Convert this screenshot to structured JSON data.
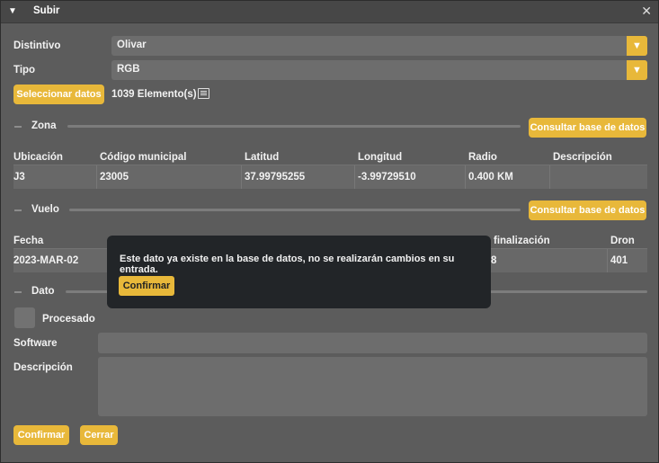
{
  "window": {
    "title": "Subir",
    "collapse_icon": "triangle-down-icon",
    "close_icon": "close-icon",
    "close_glyph": "✕"
  },
  "form": {
    "distintivo": {
      "label": "Distintivo",
      "value": "Olivar"
    },
    "tipo": {
      "label": "Tipo",
      "value": "RGB"
    },
    "select_data_button": "Seleccionar datos",
    "elements_count": "1039 Elemento(s)",
    "list_icon": "list-icon"
  },
  "zona": {
    "title": "Zona",
    "query_button": "Consultar base de datos",
    "columns": [
      "Ubicación",
      "Código municipal",
      "Latitud",
      "Longitud",
      "Radio",
      "Descripción"
    ],
    "rows": [
      [
        "J3",
        "23005",
        "37.99795255",
        "-3.99729510",
        "0.400 KM",
        ""
      ]
    ]
  },
  "vuelo": {
    "title": "Vuelo",
    "query_button": "Consultar base de datos",
    "columns_visible": {
      "fecha": "Fecha",
      "fin": "finalización",
      "dron": "Dron"
    },
    "row": {
      "fecha": "2023-MAR-02",
      "fin": "8",
      "dron": "401"
    }
  },
  "dato": {
    "title": "Dato",
    "procesado_label": "Procesado",
    "procesado_checked": false,
    "software_label": "Software",
    "software_value": "",
    "descripcion_label": "Descripción",
    "descripcion_value": ""
  },
  "footer": {
    "confirm_button": "Confirmar",
    "close_button": "Cerrar"
  },
  "modal": {
    "message": "Este dato ya existe en la base de datos, no se realizarán cambios en su entrada.",
    "confirm_button": "Confirmar"
  },
  "colors": {
    "accent": "#e8b83a",
    "panel": "#5c5c5c",
    "modal": "#222528"
  }
}
